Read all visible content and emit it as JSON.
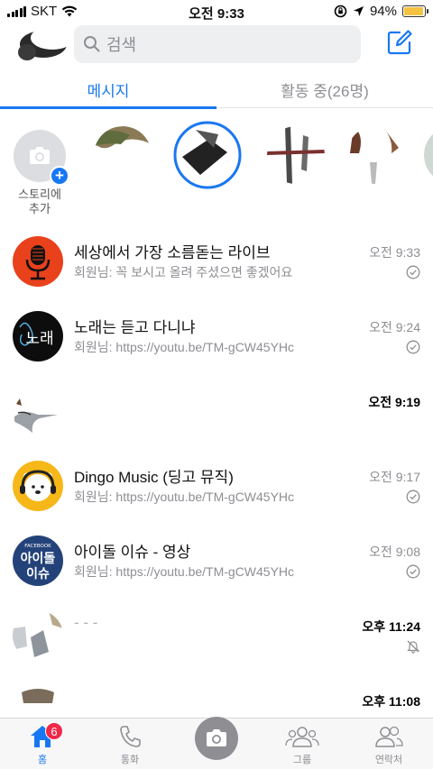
{
  "status_bar": {
    "carrier": "SKT",
    "time": "오전 9:33",
    "battery": "94%",
    "battery_level": 0.94
  },
  "search": {
    "placeholder": "검색"
  },
  "tabs": {
    "messages": "메시지",
    "active": "활동 중(26명)"
  },
  "stories": {
    "add_label": "스토리에\n추가"
  },
  "conversations": [
    {
      "name": "세상에서 가장 소름돋는 라이브",
      "preview": "회원님: 꼭 보시고 올려 주셨으면 좋겠어요",
      "time": "오전 9:33",
      "unread": false,
      "icon": "check-circle-icon"
    },
    {
      "name": "노래는 듣고 다니냐",
      "preview": "회원님: https://youtu.be/TM-gCW45YHc",
      "time": "오전 9:24",
      "unread": false,
      "icon": "check-circle-icon"
    },
    {
      "name": "",
      "preview": "",
      "time": "오전 9:19",
      "unread": true,
      "icon": ""
    },
    {
      "name": "Dingo Music (딩고 뮤직)",
      "preview": "회원님: https://youtu.be/TM-gCW45YHc",
      "time": "오전 9:17",
      "unread": false,
      "icon": "check-circle-icon"
    },
    {
      "name": "아이돌 이슈 - 영상",
      "preview": "회원님: https://youtu.be/TM-gCW45YHc",
      "time": "오전 9:08",
      "unread": false,
      "icon": "check-circle-icon"
    },
    {
      "name": "- - -",
      "preview": "",
      "time": "오후 11:24",
      "unread": true,
      "icon": "muted-bell-icon"
    },
    {
      "name": "",
      "preview": "",
      "time": "오후 11:08",
      "unread": true,
      "icon": ""
    }
  ],
  "avatar_text": {
    "idol_top": "FACEBOOK",
    "idol_1": "아이돌",
    "idol_2": "이슈",
    "song": "노래"
  },
  "tabbar": {
    "home": "홈",
    "home_badge": "6",
    "calls": "통화",
    "groups": "그룹",
    "contacts": "연락처"
  },
  "colors": {
    "accent": "#1877f2",
    "badge": "#f02849"
  }
}
